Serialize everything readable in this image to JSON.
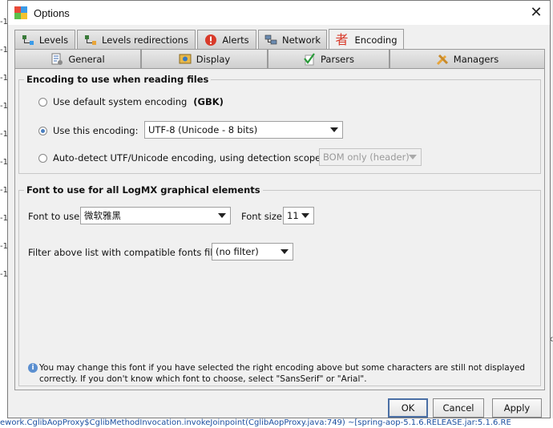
{
  "window": {
    "title": "Options",
    "close_label": "✕"
  },
  "tabs_row1": [
    {
      "label": "Levels"
    },
    {
      "label": "Levels redirections"
    },
    {
      "label": "Alerts"
    },
    {
      "label": "Network"
    },
    {
      "label": "Encoding",
      "icon_glyph": "者"
    }
  ],
  "tabs_row2": [
    {
      "label": "General"
    },
    {
      "label": "Display"
    },
    {
      "label": "Parsers"
    },
    {
      "label": "Managers"
    }
  ],
  "encoding_group": {
    "legend": "Encoding to use when reading files",
    "option_default": "Use default system encoding",
    "default_value": "(GBK)",
    "option_this": "Use this encoding:",
    "this_value": "UTF-8  (Unicode - 8 bits)",
    "option_auto": "Auto-detect UTF/Unicode encoding, using detection scope:",
    "auto_value": "BOM only (header)",
    "selected": "this"
  },
  "font_group": {
    "legend": "Font to use for all LogMX graphical elements",
    "font_label": "Font to use:",
    "font_value": "微软雅黑",
    "size_label": "Font size:",
    "size_value": "11",
    "filter_label": "Filter above list with compatible fonts filter:",
    "filter_value": "(no filter)"
  },
  "info_text": "You may change this font if you have selected the right encoding above but some characters are still not displayed correctly. If you don't know which font to choose, select \"SansSerif\" or \"Arial\".",
  "buttons": {
    "ok": "OK",
    "cancel": "Cancel",
    "apply": "Apply"
  },
  "background": {
    "bottom_text": "ework.CglibAopProxy$CglibMethodInvocation.invokeJoinpoint(CglibAopProxy.java:749) ~[spring-aop-5.1.6.RELEASE.jar:5.1.6.RE",
    "left_fragment": "-1",
    "right_fragment": "rk"
  },
  "colors": {
    "accent": "#4a7fc0",
    "default_button_border": "#4a6fa5"
  }
}
